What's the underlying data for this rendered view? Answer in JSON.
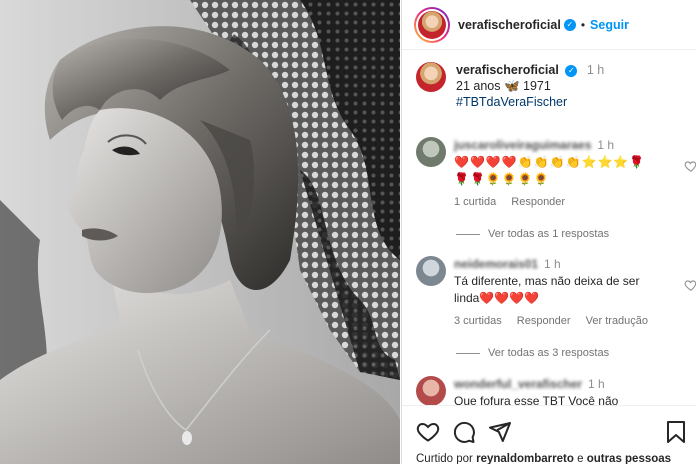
{
  "post": {
    "username": "verafischeroficial",
    "verified_mark": "✓",
    "follow_label": "Seguir",
    "dot": "•"
  },
  "caption": {
    "username": "verafischeroficial",
    "time": "1 h",
    "text": "21 anos 🦋 1971",
    "hashtag": "#TBTdaVeraFischer"
  },
  "comments": [
    {
      "username": "juscaroliveiraguimaraes",
      "time": "1 h",
      "text_line1": "❤️❤️❤️❤️👏👏👏👏⭐⭐⭐🌹",
      "text_line2": "🌹🌹🌻🌻🌻🌻",
      "likes": "1 curtida",
      "reply": "Responder",
      "translate": "",
      "view_replies": "Ver todas as 1 respostas"
    },
    {
      "username": "neidemorais01",
      "time": "1 h",
      "text_line1": "Tá diferente, mas não deixa de ser",
      "text_line2": "linda❤️❤️❤️❤️",
      "likes": "3 curtidas",
      "reply": "Responder",
      "translate": "Ver tradução",
      "view_replies": "Ver todas as 3 respostas"
    },
    {
      "username": "wonderful_verafischer",
      "time": "1 h",
      "text_line1": "Que fofura esse TBT Você não"
    }
  ],
  "footer": {
    "liked_prefix": "Curtido por",
    "liked_user": "reynaldombarreto",
    "liked_middle": "e",
    "liked_others": "outras pessoas"
  },
  "icons": {
    "like": "heart-icon",
    "comment": "comment-icon",
    "share": "share-icon",
    "save": "bookmark-icon"
  },
  "colors": {
    "accent": "#0095f6",
    "hashtag": "#00376b",
    "muted": "#737373"
  }
}
